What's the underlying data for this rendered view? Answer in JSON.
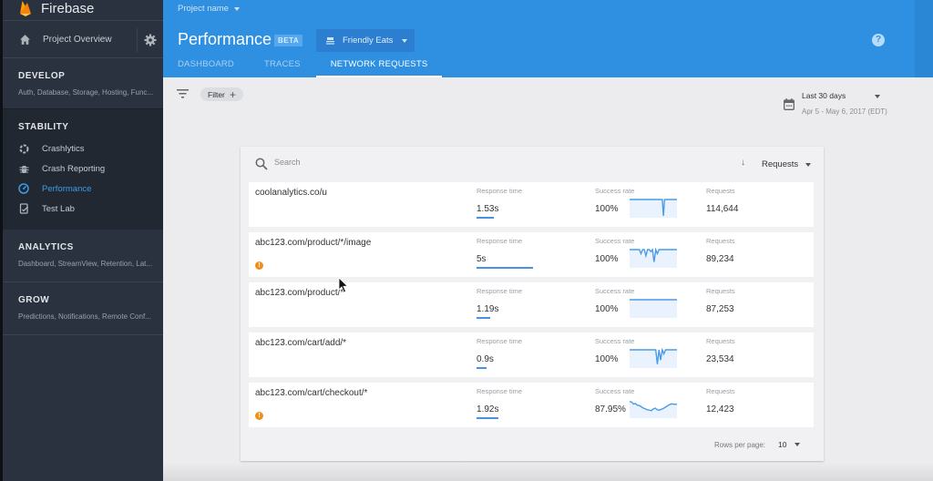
{
  "sidebar": {
    "brand": "Firebase",
    "overview": "Project Overview",
    "sections": [
      {
        "title": "DEVELOP",
        "subtitle": "Auth, Database, Storage, Hosting, Func..."
      },
      {
        "title": "STABILITY",
        "items": [
          {
            "label": "Crashlytics",
            "icon": "crashlytics-icon",
            "active": false
          },
          {
            "label": "Crash Reporting",
            "icon": "bug-icon",
            "active": false
          },
          {
            "label": "Performance",
            "icon": "speedometer-icon",
            "active": true
          },
          {
            "label": "Test Lab",
            "icon": "test-lab-icon",
            "active": false
          }
        ]
      },
      {
        "title": "ANALYTICS",
        "subtitle": "Dashboard, StreamView, Retention, Lat..."
      },
      {
        "title": "GROW",
        "subtitle": "Predictions, Notifications, Remote Conf..."
      }
    ]
  },
  "header": {
    "project": "Project name",
    "title": "Performance",
    "badge": "BETA",
    "app": "Friendly Eats",
    "help_icon": "?",
    "tabs": [
      {
        "label": "DASHBOARD",
        "active": false
      },
      {
        "label": "TRACES",
        "active": false
      },
      {
        "label": "NETWORK REQUESTS",
        "active": true
      }
    ]
  },
  "filter": {
    "label": "Filter",
    "plus": "+"
  },
  "date": {
    "range": "Last 30 days",
    "dates": "Apr 5 - May 6, 2017 (EDT)"
  },
  "table": {
    "search_placeholder": "Search",
    "sort_arrow": "↓",
    "sort_by": "Requests",
    "labels": {
      "response": "Response time",
      "success": "Success rate",
      "requests": "Requests"
    },
    "rows": [
      {
        "url": "coolanalytics.co/u",
        "warning": false,
        "response": "1.53s",
        "response_fraction": 0.31,
        "success": "100%",
        "requests": "114,644",
        "spark": [
          100,
          100,
          100,
          100,
          100,
          100,
          100,
          100,
          100,
          100,
          100,
          100,
          100,
          100,
          100,
          100,
          100,
          100,
          100,
          100,
          100,
          100,
          100,
          100,
          100,
          100,
          100,
          100,
          100,
          100,
          60,
          100,
          100,
          100,
          100,
          100,
          100,
          100,
          100,
          100,
          100,
          100,
          100
        ]
      },
      {
        "url": "abc123.com/product/*/image",
        "warning": true,
        "response": "5s",
        "response_fraction": 1.0,
        "success": "100%",
        "requests": "89,234",
        "spark": [
          100,
          100,
          100,
          100,
          100,
          100,
          100,
          90,
          100,
          100,
          85,
          100,
          100,
          95,
          100,
          70,
          100,
          90,
          100,
          100,
          100,
          100,
          100,
          100,
          100,
          100,
          100,
          100,
          100,
          100
        ]
      },
      {
        "url": "abc123.com/product/*",
        "warning": false,
        "response": "1.19s",
        "response_fraction": 0.24,
        "success": "100%",
        "requests": "87,253",
        "spark": [
          100,
          100,
          100,
          100,
          100,
          100,
          100,
          100,
          100,
          100,
          100,
          100,
          100,
          100,
          100,
          100,
          100,
          100,
          100,
          100,
          100,
          100,
          100,
          100,
          100,
          100,
          100,
          100,
          100,
          100
        ]
      },
      {
        "url": "abc123.com/cart/add/*",
        "warning": false,
        "response": "0.9s",
        "response_fraction": 0.18,
        "success": "100%",
        "requests": "23,534",
        "spark": [
          100,
          100,
          100,
          100,
          100,
          100,
          100,
          100,
          100,
          100,
          100,
          100,
          100,
          100,
          100,
          100,
          100,
          65,
          100,
          75,
          100,
          90,
          100,
          100,
          100,
          100,
          100,
          100,
          100,
          100
        ]
      },
      {
        "url": "abc123.com/cart/checkout/*",
        "warning": true,
        "response": "1.92s",
        "response_fraction": 0.38,
        "success": "87.95%",
        "requests": "12,423",
        "spark": [
          96,
          95,
          90,
          91,
          87,
          86,
          83,
          80,
          78,
          76,
          75,
          74,
          78,
          80,
          76,
          75,
          77,
          79,
          82,
          85,
          88,
          90,
          90,
          89,
          90
        ]
      }
    ],
    "rows_per_page_label": "Rows per page:",
    "rows_per_page": "10"
  },
  "colors": {
    "accent": "#2f8fe0",
    "active_nav": "#3d9be9",
    "warning": "#f0901b",
    "spark": "#4a9be8"
  }
}
